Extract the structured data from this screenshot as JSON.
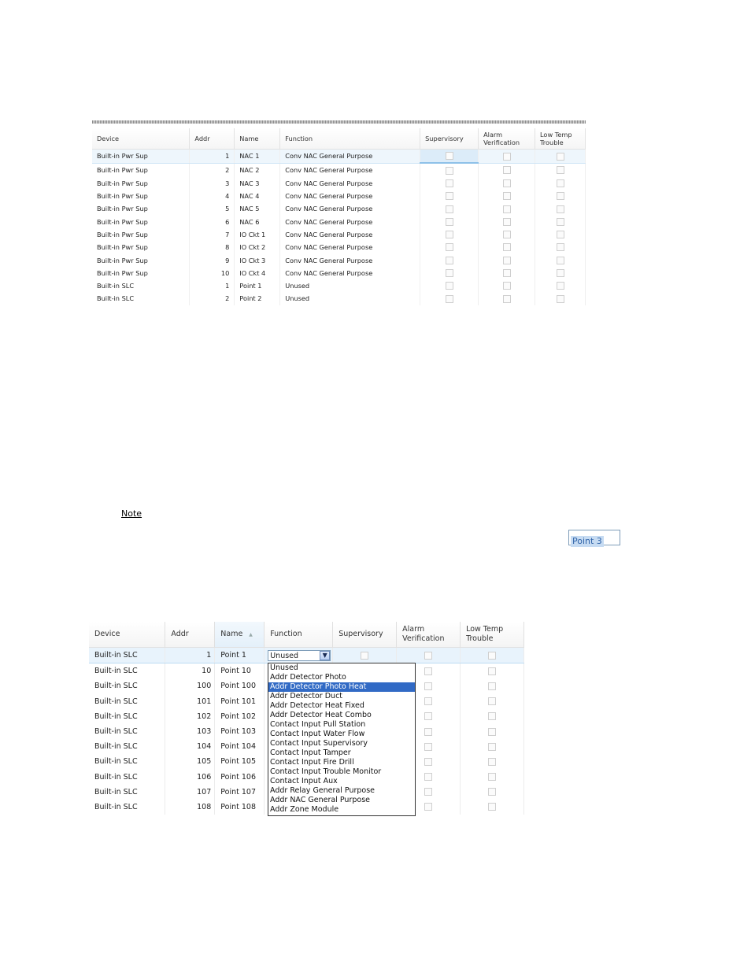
{
  "grid1": {
    "headers": [
      "Device",
      "Addr",
      "Name",
      "Function",
      "Supervisory",
      "Alarm\nVerification",
      "Low Temp\nTrouble"
    ],
    "rows": [
      {
        "device": "Built-in Pwr Sup",
        "addr": "1",
        "name": "NAC 1",
        "function": "Conv NAC General Purpose",
        "selected": true
      },
      {
        "device": "Built-in Pwr Sup",
        "addr": "2",
        "name": "NAC 2",
        "function": "Conv NAC General Purpose"
      },
      {
        "device": "Built-in Pwr Sup",
        "addr": "3",
        "name": "NAC 3",
        "function": "Conv NAC General Purpose"
      },
      {
        "device": "Built-in Pwr Sup",
        "addr": "4",
        "name": "NAC 4",
        "function": "Conv NAC General Purpose"
      },
      {
        "device": "Built-in Pwr Sup",
        "addr": "5",
        "name": "NAC 5",
        "function": "Conv NAC General Purpose"
      },
      {
        "device": "Built-in Pwr Sup",
        "addr": "6",
        "name": "NAC 6",
        "function": "Conv NAC General Purpose"
      },
      {
        "device": "Built-in Pwr Sup",
        "addr": "7",
        "name": "IO Ckt 1",
        "function": "Conv NAC General Purpose"
      },
      {
        "device": "Built-in Pwr Sup",
        "addr": "8",
        "name": "IO Ckt 2",
        "function": "Conv NAC General Purpose"
      },
      {
        "device": "Built-in Pwr Sup",
        "addr": "9",
        "name": "IO Ckt 3",
        "function": "Conv NAC General Purpose"
      },
      {
        "device": "Built-in Pwr Sup",
        "addr": "10",
        "name": "IO Ckt 4",
        "function": "Conv NAC General Purpose"
      },
      {
        "device": "Built-in SLC",
        "addr": "1",
        "name": "Point 1",
        "function": "Unused"
      },
      {
        "device": "Built-in SLC",
        "addr": "2",
        "name": "Point 2",
        "function": "Unused"
      }
    ]
  },
  "note": {
    "label": "Note",
    "edit_value": "Point 3"
  },
  "grid2": {
    "headers": [
      "Device",
      "Addr",
      "Name",
      "Function",
      "Supervisory",
      "Alarm\nVerification",
      "Low Temp\nTrouble"
    ],
    "sorted_column": "Name",
    "rows": [
      {
        "device": "Built-in SLC",
        "addr": "1",
        "name": "Point 1",
        "function": "Unused",
        "selected": true
      },
      {
        "device": "Built-in SLC",
        "addr": "10",
        "name": "Point 10",
        "function": ""
      },
      {
        "device": "Built-in SLC",
        "addr": "100",
        "name": "Point 100",
        "function": ""
      },
      {
        "device": "Built-in SLC",
        "addr": "101",
        "name": "Point 101",
        "function": ""
      },
      {
        "device": "Built-in SLC",
        "addr": "102",
        "name": "Point 102",
        "function": ""
      },
      {
        "device": "Built-in SLC",
        "addr": "103",
        "name": "Point 103",
        "function": ""
      },
      {
        "device": "Built-in SLC",
        "addr": "104",
        "name": "Point 104",
        "function": ""
      },
      {
        "device": "Built-in SLC",
        "addr": "105",
        "name": "Point 105",
        "function": ""
      },
      {
        "device": "Built-in SLC",
        "addr": "106",
        "name": "Point 106",
        "function": ""
      },
      {
        "device": "Built-in SLC",
        "addr": "107",
        "name": "Point 107",
        "function": ""
      },
      {
        "device": "Built-in SLC",
        "addr": "108",
        "name": "Point 108",
        "function": ""
      }
    ],
    "function_combo_value": "Unused",
    "dropdown_options": [
      "Unused",
      "Addr Detector Photo",
      "Addr Detector Photo Heat",
      "Addr Detector Duct",
      "Addr Detector Heat Fixed",
      "Addr Detector Heat Combo",
      "Contact Input Pull Station",
      "Contact Input Water Flow",
      "Contact Input Supervisory",
      "Contact Input Tamper",
      "Contact Input Fire Drill",
      "Contact Input Trouble Monitor",
      "Contact Input Aux",
      "Addr Relay General Purpose",
      "Addr NAC General Purpose",
      "Addr Zone Module"
    ],
    "dropdown_highlighted": "Addr Detector Photo Heat"
  },
  "icons": {
    "combo_arrow": "chevron-down-icon",
    "sort_arrow": "sort-ascending-icon"
  },
  "colors": {
    "selection_row": "#eef6fc",
    "dropdown_highlight": "#316ac5",
    "edit_highlight": "#c6dbf2"
  }
}
